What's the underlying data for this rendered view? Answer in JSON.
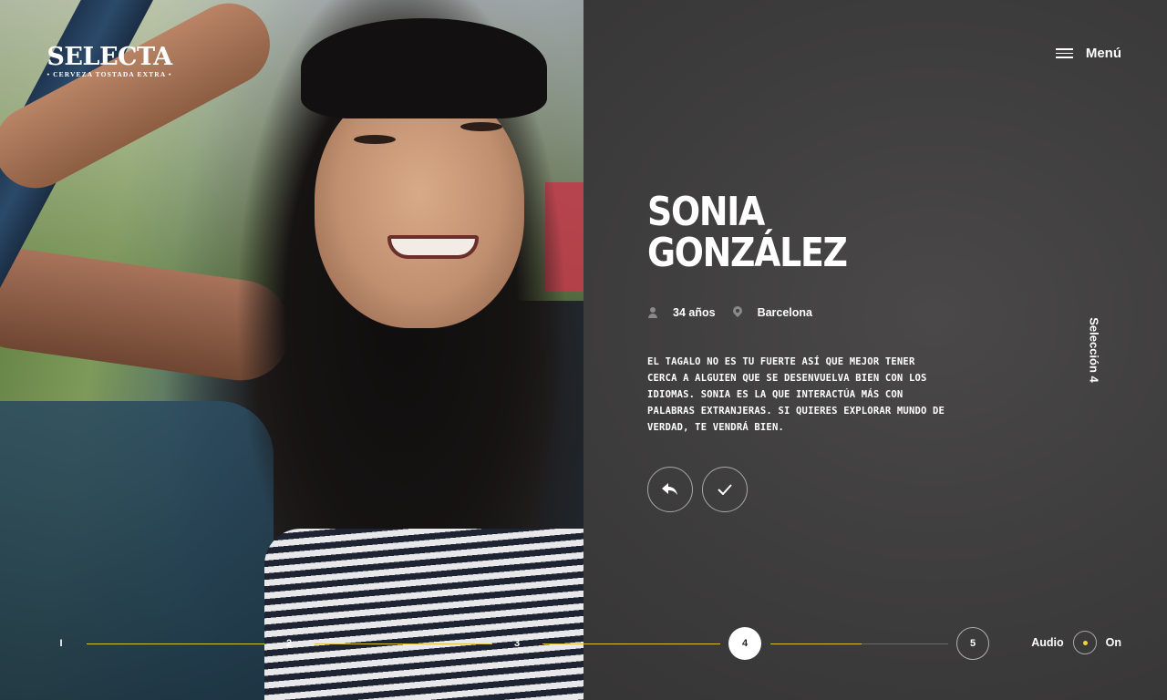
{
  "brand": {
    "name": "SELECTA",
    "tagline": "• CERVEZA TOSTADA EXTRA •"
  },
  "header": {
    "menu_label": "Menú",
    "menu_icon": "hamburger-icon"
  },
  "profile": {
    "first_name": "SONIA",
    "last_name": "GONZÁLEZ",
    "age": "34 años",
    "age_icon": "person-icon",
    "city": "Barcelona",
    "city_icon": "location-pin-icon",
    "description": "EL TAGALO NO ES TU FUERTE ASÍ QUE MEJOR TENER CERCA A ALGUIEN QUE SE DESENVUELVA BIEN CON LOS IDIOMAS. SONIA ES LA QUE INTERACTÚA MÁS CON PALABRAS EXTRANJERAS. SI QUIERES EXPLORAR MUNDO DE VERDAD, TE VENDRÁ BIEN."
  },
  "actions": {
    "back_icon": "reply-arrow-icon",
    "confirm_icon": "checkmark-icon"
  },
  "side_label": "Selección 4",
  "steps": [
    {
      "label": "I"
    },
    {
      "label": "2"
    },
    {
      "label": "3"
    },
    {
      "label": "4",
      "active": true
    },
    {
      "label": "5"
    }
  ],
  "current_step": 4,
  "audio": {
    "label": "Audio",
    "state": "On",
    "indicator_color": "#f2d23a"
  },
  "colors": {
    "accent": "#d8c23a",
    "panel_bg": "#3f3e3e"
  }
}
